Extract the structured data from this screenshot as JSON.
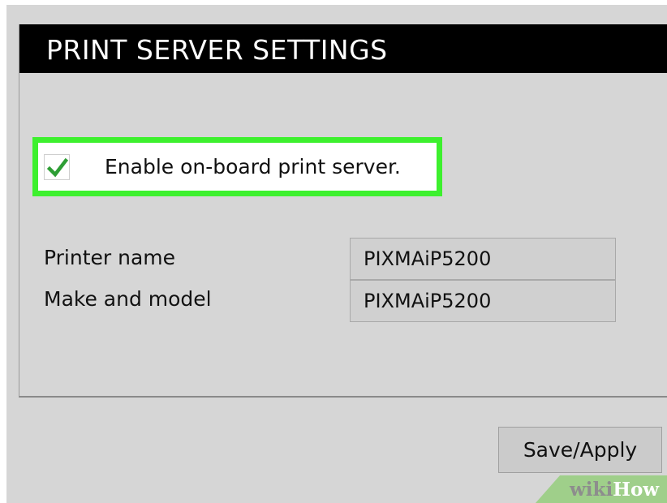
{
  "panel": {
    "title": "PRINT SERVER SETTINGS"
  },
  "enable_server": {
    "checked": true,
    "label": "Enable on-board print server.",
    "highlight_color": "#3df02e",
    "check_color": "#2e9e35"
  },
  "fields": [
    {
      "label": "Printer name",
      "value": "PIXMAiP5200"
    },
    {
      "label": "Make and model",
      "value": "PIXMAiP5200"
    }
  ],
  "actions": {
    "save_label": "Save/Apply"
  },
  "watermark": {
    "part1": "wiki",
    "part2": "How",
    "color": "#9fcf8a"
  },
  "colors": {
    "header_bg": "#000000",
    "panel_bg": "#d6d6d6"
  }
}
